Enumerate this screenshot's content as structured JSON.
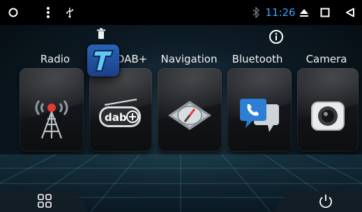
{
  "status_bar": {
    "time": "11:26",
    "left_icons": [
      "circle-icon",
      "more-vertical-icon",
      "usb-icon"
    ],
    "right_icons": [
      "bluetooth-icon",
      "eject-icon",
      "square-icon",
      "back-icon"
    ]
  },
  "launcher": {
    "labels": [
      "Radio",
      "DAB+",
      "Navigation",
      "Bluetooth",
      "Camera"
    ],
    "dragged_app_letter": "T"
  },
  "colors": {
    "accent_time": "#3aa5ff",
    "background": "#0d1c26"
  },
  "bottom_bar": {
    "left_icon": "apps-grid-icon",
    "right_icon": "power-icon"
  }
}
